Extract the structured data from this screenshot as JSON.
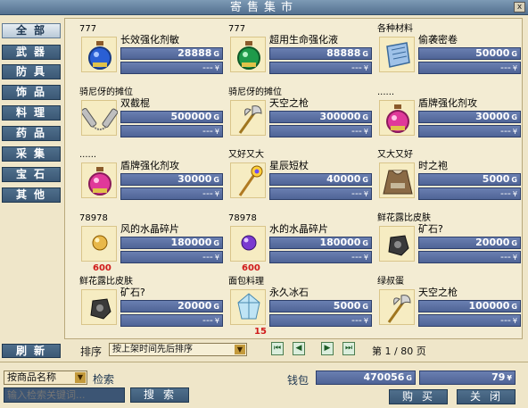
{
  "window": {
    "title": "寄售集市",
    "close_glyph": "x"
  },
  "categories": [
    {
      "label": "全部",
      "active": true
    },
    {
      "label": "武器",
      "active": false
    },
    {
      "label": "防具",
      "active": false
    },
    {
      "label": "饰品",
      "active": false
    },
    {
      "label": "料理",
      "active": false
    },
    {
      "label": "药品",
      "active": false
    },
    {
      "label": "采集",
      "active": false
    },
    {
      "label": "宝石",
      "active": false
    },
    {
      "label": "其他",
      "active": false
    }
  ],
  "refresh_label": "刷新",
  "items": [
    {
      "seller": "777",
      "name": "长效强化剂敏",
      "price": "28888",
      "yen": "---",
      "icon": "blue-potion-icon",
      "qty": ""
    },
    {
      "seller": "777",
      "name": "超用生命强化液",
      "price": "88888",
      "yen": "---",
      "icon": "green-potion-icon",
      "qty": ""
    },
    {
      "seller": "各种材料",
      "name": "偷袭密卷",
      "price": "50000",
      "yen": "---",
      "icon": "scroll-icon",
      "qty": ""
    },
    {
      "seller": "骑尼伢的摊位",
      "name": "双截棍",
      "price": "500000",
      "yen": "---",
      "icon": "nunchaku-icon",
      "qty": ""
    },
    {
      "seller": "骑尼伢的摊位",
      "name": "天空之枪",
      "price": "300000",
      "yen": "---",
      "icon": "axe-spear-icon",
      "qty": ""
    },
    {
      "seller": "......",
      "name": "盾牌强化剂攻",
      "price": "30000",
      "yen": "---",
      "icon": "pink-potion-icon",
      "qty": ""
    },
    {
      "seller": "......",
      "name": "盾牌强化剂攻",
      "price": "30000",
      "yen": "---",
      "icon": "pink-potion-icon",
      "qty": ""
    },
    {
      "seller": "又好又大",
      "name": "星辰短杖",
      "price": "40000",
      "yen": "---",
      "icon": "staff-icon",
      "qty": ""
    },
    {
      "seller": "又大又好",
      "name": "时之袍",
      "price": "5000",
      "yen": "---",
      "icon": "robe-icon",
      "qty": ""
    },
    {
      "seller": "78978",
      "name": "风的水晶碎片",
      "price": "180000",
      "yen": "---",
      "icon": "gold-orb-icon",
      "qty": "600"
    },
    {
      "seller": "78978",
      "name": "水的水晶碎片",
      "price": "180000",
      "yen": "---",
      "icon": "purple-orb-icon",
      "qty": "600"
    },
    {
      "seller": "鲜花露比皮肤",
      "name": "矿石?",
      "price": "20000",
      "yen": "---",
      "icon": "ore-icon",
      "qty": ""
    },
    {
      "seller": "鲜花露比皮肤",
      "name": "矿石?",
      "price": "20000",
      "yen": "---",
      "icon": "ore-icon",
      "qty": ""
    },
    {
      "seller": "面包料理",
      "name": "永久冰石",
      "price": "5000",
      "yen": "---",
      "icon": "ice-crystal-icon",
      "qty": "15"
    },
    {
      "seller": "绿叔蛋",
      "name": "天空之枪",
      "price": "100000",
      "yen": "---",
      "icon": "axe-spear-icon",
      "qty": ""
    }
  ],
  "currency": {
    "gold": "G",
    "yen": "¥"
  },
  "sort": {
    "label": "排序",
    "selected": "按上架时间先后排序"
  },
  "pagination": {
    "current": "1",
    "total": "80",
    "prefix": "第",
    "separator": "/",
    "suffix": "页"
  },
  "search": {
    "type_selected": "按商品名称",
    "label": "检索",
    "placeholder": "输入检索关键词...",
    "button": "搜索"
  },
  "wallet": {
    "label": "钱包",
    "gold": "470056",
    "yen": "79"
  },
  "buttons": {
    "buy": "购买",
    "close": "关闭"
  },
  "colors": {
    "title_bar": "#5f7c9a",
    "button": "#45627f",
    "price_bar": "#5d72a6",
    "qty_red": "#d01a1a"
  }
}
